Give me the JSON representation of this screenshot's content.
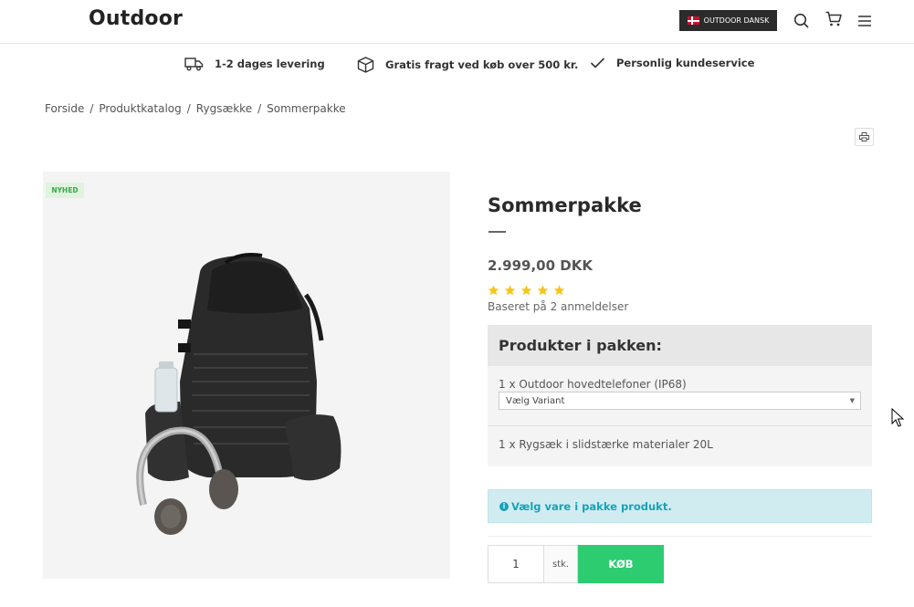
{
  "header": {
    "logo": "Outdoor",
    "language_label": "OUTDOOR DANSK",
    "icons": [
      "search-icon",
      "cart-icon",
      "menu-icon"
    ]
  },
  "usp": [
    {
      "icon": "truck-icon",
      "text": "1-2 dages levering"
    },
    {
      "icon": "box-icon",
      "text": "Gratis fragt ved køb over 500 kr."
    },
    {
      "icon": "check-icon",
      "text": "Personlig kundeservice"
    }
  ],
  "breadcrumb": {
    "items": [
      "Forside",
      "Produktkatalog",
      "Rygsække",
      "Sommerpakke"
    ],
    "separator": "/"
  },
  "product": {
    "badge": "NYHED",
    "title": "Sommerpakke",
    "price": "2.999,00 DKK",
    "rating": 5,
    "reviews": "Baseret på 2 anmeldelser",
    "star_color": "#f5c518"
  },
  "bundle": {
    "heading": "Produkter i pakken:",
    "item1": "1 x Outdoor hovedtelefoner (IP68)",
    "variant_placeholder": "Vælg Variant",
    "item2": "1 x Rygsæk i slidstærke materialer 20L"
  },
  "notice": {
    "text": "Vælg vare i pakke produkt.",
    "icon": "info-icon",
    "color": "#17a2b8"
  },
  "purchase": {
    "quantity": "1",
    "unit": "stk.",
    "buy_label": "KØB",
    "buy_color": "#2ecc71"
  }
}
